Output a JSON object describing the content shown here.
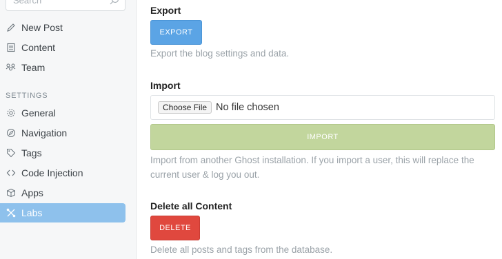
{
  "sidebar": {
    "search": {
      "placeholder": "Search"
    },
    "items": [
      {
        "label": "New Post",
        "icon": "pencil-icon"
      },
      {
        "label": "Content",
        "icon": "document-icon"
      },
      {
        "label": "Team",
        "icon": "team-icon"
      }
    ],
    "settings_label": "SETTINGS",
    "settings_items": [
      {
        "label": "General",
        "icon": "gear-icon"
      },
      {
        "label": "Navigation",
        "icon": "compass-icon"
      },
      {
        "label": "Tags",
        "icon": "tag-icon"
      },
      {
        "label": "Code Injection",
        "icon": "code-icon"
      },
      {
        "label": "Apps",
        "icon": "box-icon"
      },
      {
        "label": "Labs",
        "icon": "labs-icon",
        "active": true
      }
    ]
  },
  "export": {
    "heading": "Export",
    "button": "EXPORT",
    "description": "Export the blog settings and data."
  },
  "import": {
    "heading": "Import",
    "choose_button": "Choose File",
    "file_status": "No file chosen",
    "button": "IMPORT",
    "description": "Import from another Ghost installation. If you import a user, this will replace the current user & log you out."
  },
  "delete": {
    "heading": "Delete all Content",
    "button": "DELETE",
    "description": "Delete all posts and tags from the database."
  },
  "colors": {
    "accent_blue": "#5ba4e5",
    "import_green": "#c2d69d",
    "delete_red": "#e0483e",
    "active_nav": "#8ec1ec"
  }
}
